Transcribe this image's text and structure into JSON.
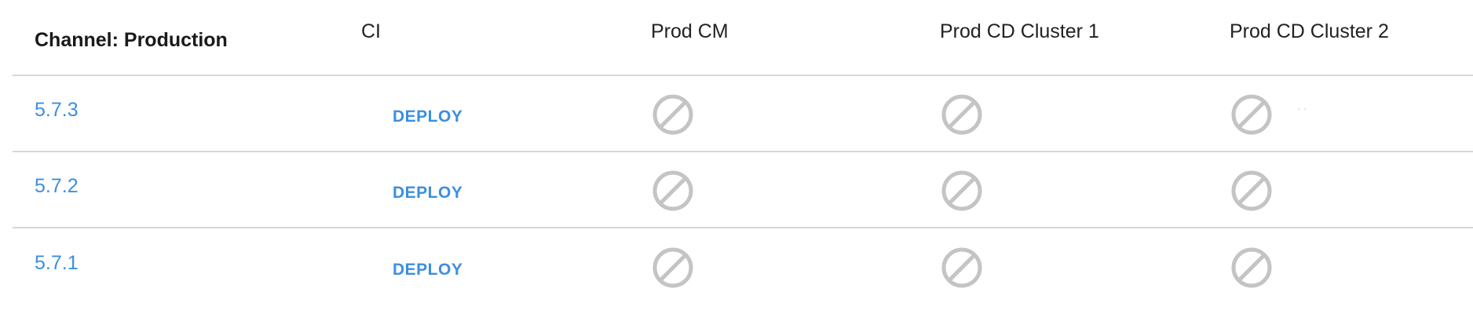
{
  "header": {
    "channel_label": "Channel: Production",
    "columns": [
      "CI",
      "Prod CM",
      "Prod CD Cluster 1",
      "Prod CD Cluster 2"
    ]
  },
  "rows": [
    {
      "version": "5.7.3",
      "action": "DEPLOY"
    },
    {
      "version": "5.7.2",
      "action": "DEPLOY"
    },
    {
      "version": "5.7.1",
      "action": "DEPLOY"
    }
  ],
  "status_icon": "blocked-icon",
  "colors": {
    "link": "#3b8fe0",
    "icon": "#c4c4c4",
    "divider": "#d7d7d7",
    "header_text": "#1a1a1a"
  }
}
